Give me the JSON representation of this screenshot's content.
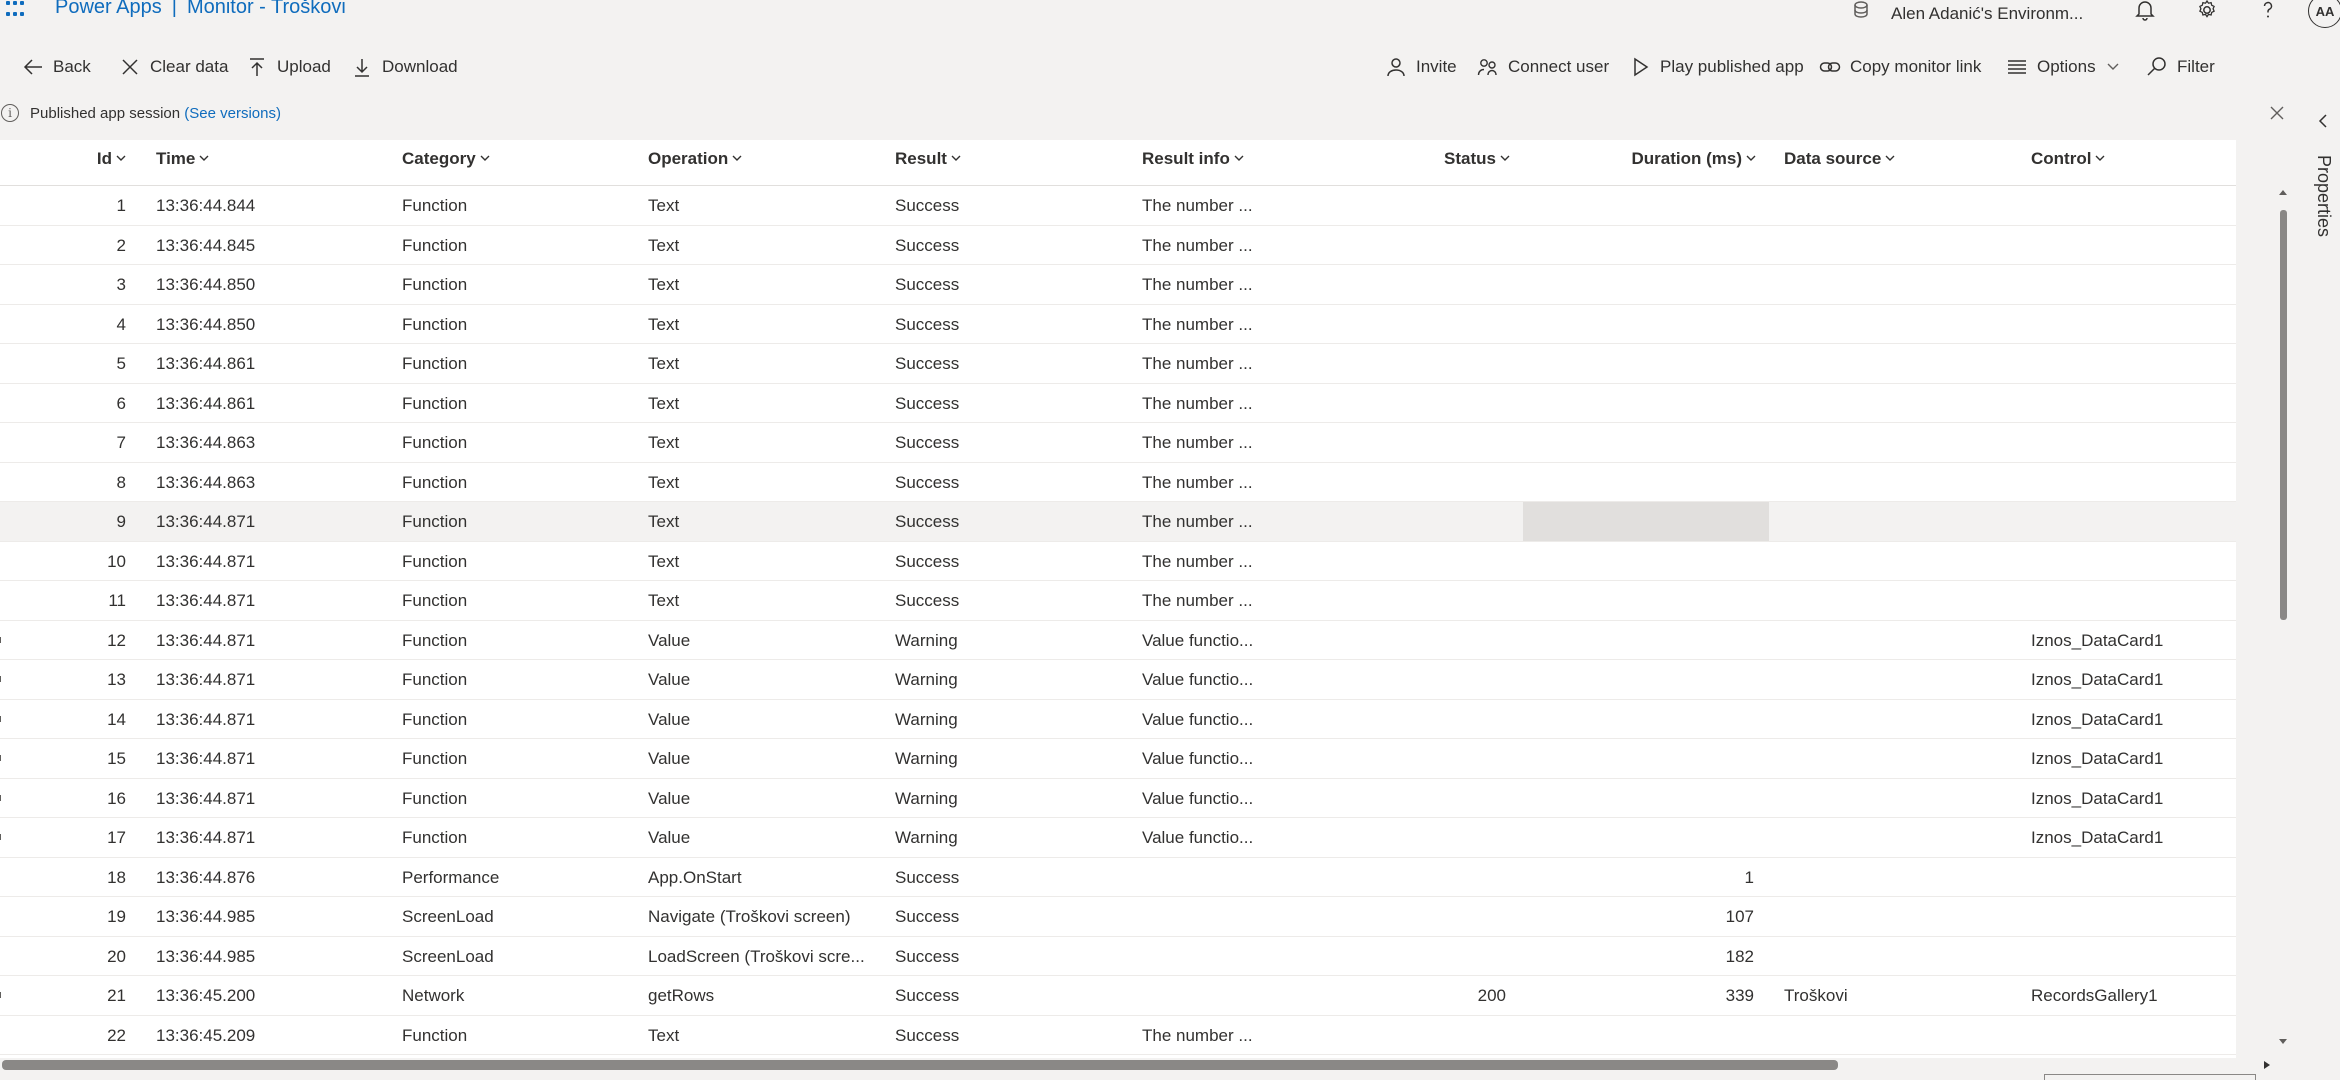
{
  "header": {
    "app_name": "Power Apps",
    "separator": "|",
    "page_title": "Monitor - Troškovi",
    "environment": "Alen Adanić's Environm...",
    "avatar_initials": "AA"
  },
  "toolbar": {
    "back": "Back",
    "clear_data": "Clear data",
    "upload": "Upload",
    "download": "Download",
    "invite": "Invite",
    "connect_user": "Connect user",
    "play_published_app": "Play published app",
    "copy_monitor_link": "Copy monitor link",
    "options": "Options",
    "filter": "Filter"
  },
  "info_bar": {
    "text": "Published app session",
    "link": "(See versions)"
  },
  "side_panel": {
    "label": "Properties"
  },
  "table": {
    "columns": {
      "id": "Id",
      "time": "Time",
      "category": "Category",
      "operation": "Operation",
      "result": "Result",
      "result_info": "Result info",
      "status": "Status",
      "duration": "Duration (ms)",
      "data_source": "Data source",
      "control": "Control"
    },
    "selected_row": 9,
    "rows": [
      {
        "id": "1",
        "time": "13:36:44.844",
        "category": "Function",
        "operation": "Text",
        "result": "Success",
        "result_info": "The number ...",
        "status": "",
        "duration": "",
        "data_source": "",
        "control": ""
      },
      {
        "id": "2",
        "time": "13:36:44.845",
        "category": "Function",
        "operation": "Text",
        "result": "Success",
        "result_info": "The number ...",
        "status": "",
        "duration": "",
        "data_source": "",
        "control": ""
      },
      {
        "id": "3",
        "time": "13:36:44.850",
        "category": "Function",
        "operation": "Text",
        "result": "Success",
        "result_info": "The number ...",
        "status": "",
        "duration": "",
        "data_source": "",
        "control": ""
      },
      {
        "id": "4",
        "time": "13:36:44.850",
        "category": "Function",
        "operation": "Text",
        "result": "Success",
        "result_info": "The number ...",
        "status": "",
        "duration": "",
        "data_source": "",
        "control": ""
      },
      {
        "id": "5",
        "time": "13:36:44.861",
        "category": "Function",
        "operation": "Text",
        "result": "Success",
        "result_info": "The number ...",
        "status": "",
        "duration": "",
        "data_source": "",
        "control": ""
      },
      {
        "id": "6",
        "time": "13:36:44.861",
        "category": "Function",
        "operation": "Text",
        "result": "Success",
        "result_info": "The number ...",
        "status": "",
        "duration": "",
        "data_source": "",
        "control": ""
      },
      {
        "id": "7",
        "time": "13:36:44.863",
        "category": "Function",
        "operation": "Text",
        "result": "Success",
        "result_info": "The number ...",
        "status": "",
        "duration": "",
        "data_source": "",
        "control": ""
      },
      {
        "id": "8",
        "time": "13:36:44.863",
        "category": "Function",
        "operation": "Text",
        "result": "Success",
        "result_info": "The number ...",
        "status": "",
        "duration": "",
        "data_source": "",
        "control": ""
      },
      {
        "id": "9",
        "time": "13:36:44.871",
        "category": "Function",
        "operation": "Text",
        "result": "Success",
        "result_info": "The number ...",
        "status": "",
        "duration": "",
        "data_source": "",
        "control": ""
      },
      {
        "id": "10",
        "time": "13:36:44.871",
        "category": "Function",
        "operation": "Text",
        "result": "Success",
        "result_info": "The number ...",
        "status": "",
        "duration": "",
        "data_source": "",
        "control": ""
      },
      {
        "id": "11",
        "time": "13:36:44.871",
        "category": "Function",
        "operation": "Text",
        "result": "Success",
        "result_info": "The number ...",
        "status": "",
        "duration": "",
        "data_source": "",
        "control": ""
      },
      {
        "id": "12",
        "time": "13:36:44.871",
        "category": "Function",
        "operation": "Value",
        "result": "Warning",
        "result_info": "Value functio...",
        "status": "",
        "duration": "",
        "data_source": "",
        "control": "Iznos_DataCard1"
      },
      {
        "id": "13",
        "time": "13:36:44.871",
        "category": "Function",
        "operation": "Value",
        "result": "Warning",
        "result_info": "Value functio...",
        "status": "",
        "duration": "",
        "data_source": "",
        "control": "Iznos_DataCard1"
      },
      {
        "id": "14",
        "time": "13:36:44.871",
        "category": "Function",
        "operation": "Value",
        "result": "Warning",
        "result_info": "Value functio...",
        "status": "",
        "duration": "",
        "data_source": "",
        "control": "Iznos_DataCard1"
      },
      {
        "id": "15",
        "time": "13:36:44.871",
        "category": "Function",
        "operation": "Value",
        "result": "Warning",
        "result_info": "Value functio...",
        "status": "",
        "duration": "",
        "data_source": "",
        "control": "Iznos_DataCard1"
      },
      {
        "id": "16",
        "time": "13:36:44.871",
        "category": "Function",
        "operation": "Value",
        "result": "Warning",
        "result_info": "Value functio...",
        "status": "",
        "duration": "",
        "data_source": "",
        "control": "Iznos_DataCard1"
      },
      {
        "id": "17",
        "time": "13:36:44.871",
        "category": "Function",
        "operation": "Value",
        "result": "Warning",
        "result_info": "Value functio...",
        "status": "",
        "duration": "",
        "data_source": "",
        "control": "Iznos_DataCard1"
      },
      {
        "id": "18",
        "time": "13:36:44.876",
        "category": "Performance",
        "operation": "App.OnStart",
        "result": "Success",
        "result_info": "",
        "status": "",
        "duration": "1",
        "data_source": "",
        "control": ""
      },
      {
        "id": "19",
        "time": "13:36:44.985",
        "category": "ScreenLoad",
        "operation": "Navigate (Troškovi screen)",
        "result": "Success",
        "result_info": "",
        "status": "",
        "duration": "107",
        "data_source": "",
        "control": ""
      },
      {
        "id": "20",
        "time": "13:36:44.985",
        "category": "ScreenLoad",
        "operation": "LoadScreen (Troškovi scre...",
        "result": "Success",
        "result_info": "",
        "status": "",
        "duration": "182",
        "data_source": "",
        "control": ""
      },
      {
        "id": "21",
        "time": "13:36:45.200",
        "category": "Network",
        "operation": "getRows",
        "result": "Success",
        "result_info": "",
        "status": "200",
        "duration": "339",
        "data_source": "Troškovi",
        "control": "RecordsGallery1"
      },
      {
        "id": "22",
        "time": "13:36:45.209",
        "category": "Function",
        "operation": "Text",
        "result": "Success",
        "result_info": "The number ...",
        "status": "",
        "duration": "",
        "data_source": "",
        "control": ""
      }
    ]
  }
}
